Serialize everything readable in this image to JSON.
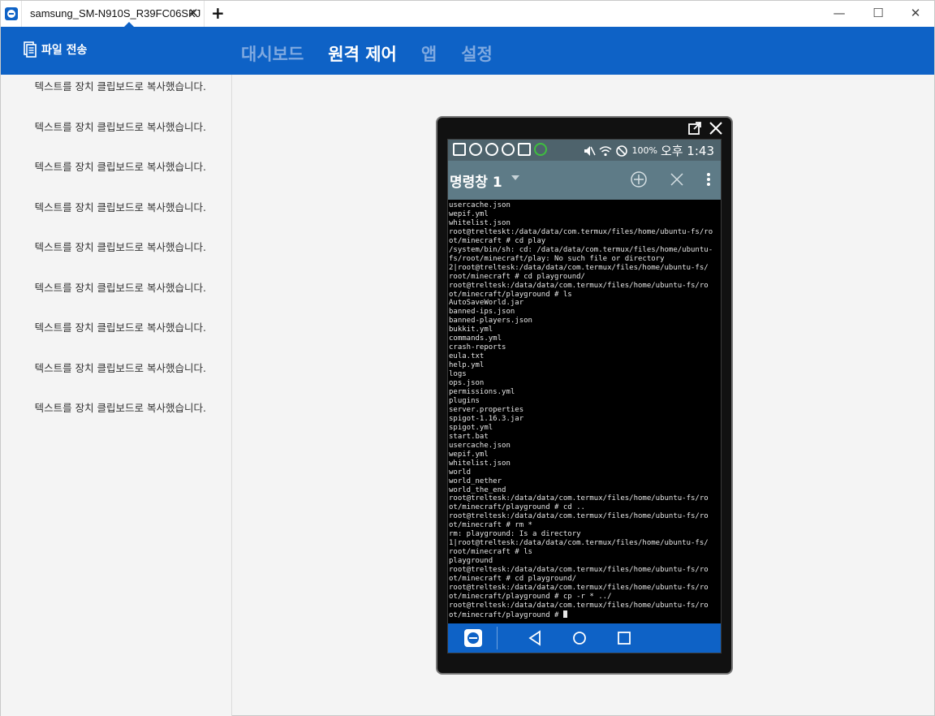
{
  "tab": {
    "title": "samsung_SM-N910S_R39FC06SKJ",
    "close": "✕",
    "new_tab": "+"
  },
  "window_controls": {
    "minimize": "—",
    "maximize": "☐",
    "close": "✕"
  },
  "header": {
    "file_transfer": "파일 전송",
    "nav": [
      "대시보드",
      "원격 제어",
      "앱",
      "설정"
    ],
    "active_nav": "원격 제어"
  },
  "messages": [
    "텍스트를 장치 클립보드로 복사했습니다.",
    "텍스트를 장치 클립보드로 복사했습니다.",
    "텍스트를 장치 클립보드로 복사했습니다.",
    "텍스트를 장치 클립보드로 복사했습니다.",
    "텍스트를 장치 클립보드로 복사했습니다.",
    "텍스트를 장치 클립보드로 복사했습니다.",
    "텍스트를 장치 클립보드로 복사했습니다.",
    "텍스트를 장치 클립보드로 복사했습니다.",
    "텍스트를 장치 클립보드로 복사했습니다."
  ],
  "phone": {
    "status": {
      "battery": "100%",
      "time": "오후 1:43"
    },
    "app_title": "명령창 1",
    "terminal_lines": [
      "usercache.json",
      "wepif.yml",
      "whitelist.json",
      "root@trelteskt:/data/data/com.termux/files/home/ubuntu-fs/ro",
      "ot/minecraft # cd play",
      "/system/bin/sh: cd: /data/data/com.termux/files/home/ubuntu-",
      "fs/root/minecraft/play: No such file or directory",
      "2|root@treltesk:/data/data/com.termux/files/home/ubuntu-fs/",
      "root/minecraft # cd playground/",
      "root@treltesk:/data/data/com.termux/files/home/ubuntu-fs/ro",
      "ot/minecraft/playground # ls",
      "AutoSaveWorld.jar",
      "banned-ips.json",
      "banned-players.json",
      "bukkit.yml",
      "commands.yml",
      "crash-reports",
      "eula.txt",
      "help.yml",
      "logs",
      "ops.json",
      "permissions.yml",
      "plugins",
      "server.properties",
      "spigot-1.16.3.jar",
      "spigot.yml",
      "start.bat",
      "usercache.json",
      "wepif.yml",
      "whitelist.json",
      "world",
      "world_nether",
      "world_the_end",
      "root@treltesk:/data/data/com.termux/files/home/ubuntu-fs/ro",
      "ot/minecraft/playground # cd ..",
      "root@treltesk:/data/data/com.termux/files/home/ubuntu-fs/ro",
      "ot/minecraft # rm *",
      "rm: playground: Is a directory",
      "1|root@treltesk:/data/data/com.termux/files/home/ubuntu-fs/",
      "root/minecraft # ls",
      "playground",
      "root@treltesk:/data/data/com.termux/files/home/ubuntu-fs/ro",
      "ot/minecraft # cd playground/",
      "root@treltesk:/data/data/com.termux/files/home/ubuntu-fs/ro",
      "ot/minecraft/playground # cp -r * ../",
      "root@treltesk:/data/data/com.termux/files/home/ubuntu-fs/ro",
      "ot/minecraft/playground # "
    ]
  },
  "colors": {
    "accent": "#0e62c6",
    "appbar": "#5e7b87",
    "statusbar": "#4e636c"
  }
}
